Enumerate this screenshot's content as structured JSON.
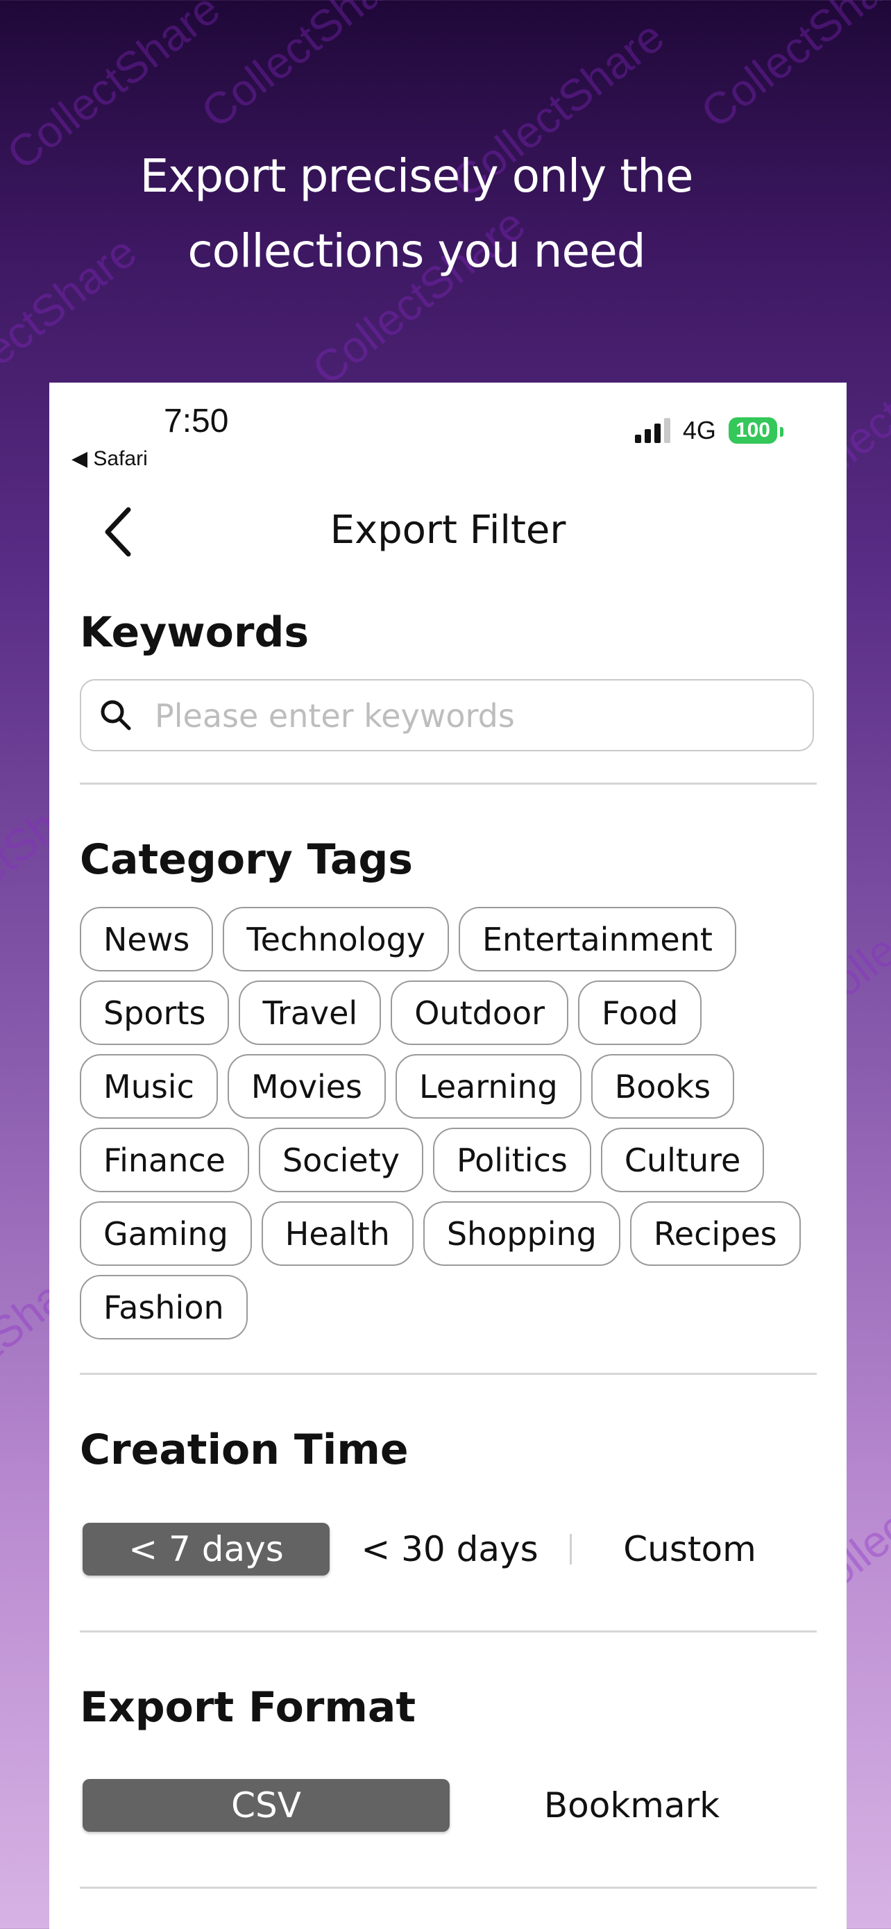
{
  "headline": {
    "line1": "Export precisely only the",
    "line2": "collections you need"
  },
  "watermark": "CollectShare",
  "status_bar": {
    "time": "7:50",
    "back_app": "◀ Safari",
    "network": "4G",
    "battery": "100",
    "battery_color": "#34c759"
  },
  "nav": {
    "title": "Export Filter",
    "back_icon": "chevron-left-icon"
  },
  "keywords": {
    "title": "Keywords",
    "placeholder": "Please enter keywords",
    "value": ""
  },
  "category_tags": {
    "title": "Category Tags",
    "tags": [
      "News",
      "Technology",
      "Entertainment",
      "Sports",
      "Travel",
      "Outdoor",
      "Food",
      "Music",
      "Movies",
      "Learning",
      "Books",
      "Finance",
      "Society",
      "Politics",
      "Culture",
      "Gaming",
      "Health",
      "Shopping",
      "Recipes",
      "Fashion"
    ]
  },
  "creation_time": {
    "title": "Creation Time",
    "options": [
      "< 7 days",
      "< 30 days",
      "Custom"
    ],
    "selected": "< 7 days"
  },
  "export_format": {
    "title": "Export Format",
    "options": [
      "CSV",
      "Bookmark"
    ],
    "selected": "CSV"
  },
  "colors": {
    "accent_selected": "#636363",
    "watermark": "#8b28c9"
  }
}
